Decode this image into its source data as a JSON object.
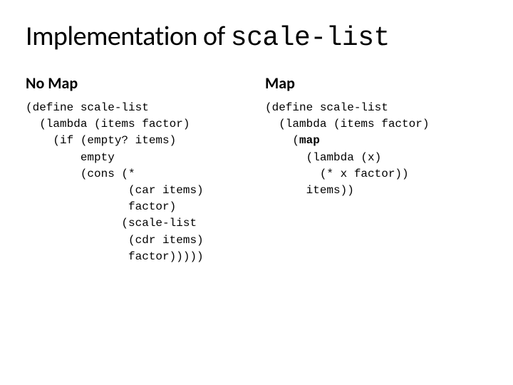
{
  "title": {
    "prefix": "Implementation of ",
    "code": "scale-list"
  },
  "left": {
    "heading": "No Map",
    "lines": [
      "(define scale-list",
      "  (lambda (items factor)",
      "    (if (empty? items)",
      "        empty",
      "        (cons (*",
      "               (car items)",
      "               factor)",
      "              (scale-list",
      "               (cdr items)",
      "               factor)))))"
    ]
  },
  "right": {
    "heading": "Map",
    "lines": [
      "(define scale-list",
      "  (lambda (items factor)",
      "    (",
      "      (lambda (x)",
      "        (* x factor))",
      "      items))"
    ],
    "bold_keyword": "map"
  }
}
